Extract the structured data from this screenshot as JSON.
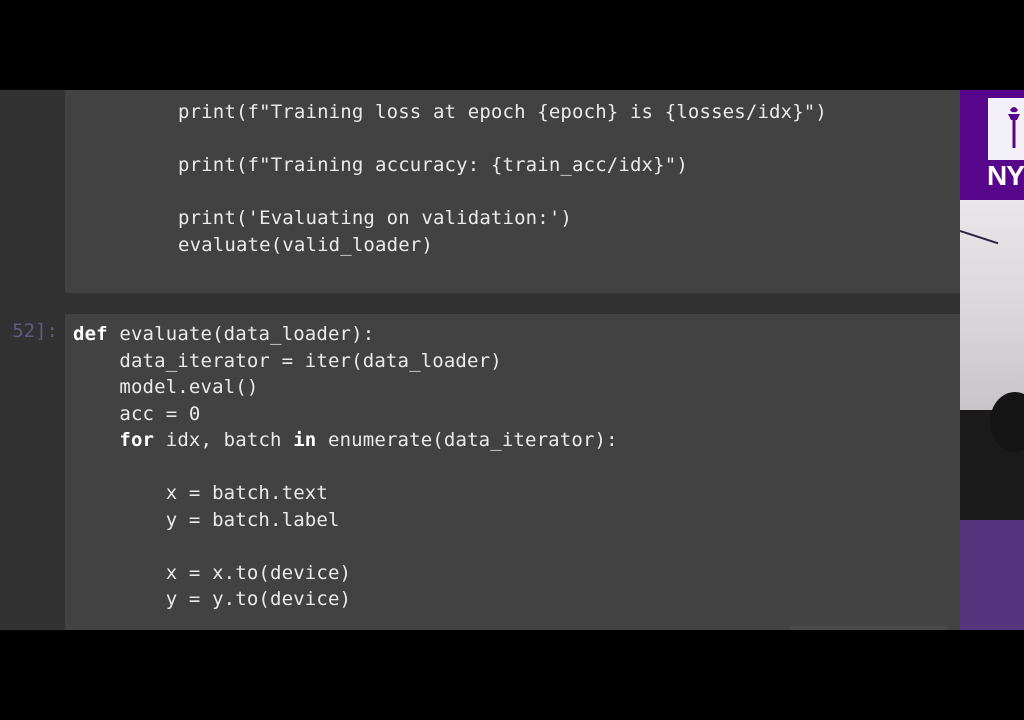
{
  "notebook": {
    "prev_cell": {
      "lines": [
        "print(f\"Training loss at epoch {epoch} is {losses/idx}\")",
        "",
        "print(f\"Training accuracy: {train_acc/idx}\")",
        "",
        "print('Evaluating on validation:')",
        "evaluate(valid_loader)"
      ]
    },
    "current_cell": {
      "prompt": "52]:",
      "lines": [
        "def evaluate(data_loader):",
        "    data_iterator = iter(data_loader)",
        "    model.eval()",
        "    acc = 0",
        "    for idx, batch in enumerate(data_iterator):",
        "",
        "        x = batch.text",
        "        y = batch.label",
        "",
        "        x = x.to(device)",
        "        y = y.to(device)"
      ]
    }
  },
  "video": {
    "logo_text": "NY"
  },
  "colors": {
    "background": "#000000",
    "notebook_bg": "#323232",
    "cell_bg": "#424242",
    "code_text": "#eaeaea",
    "prompt": "#5f5a86",
    "nyu_purple": "#57068c"
  }
}
